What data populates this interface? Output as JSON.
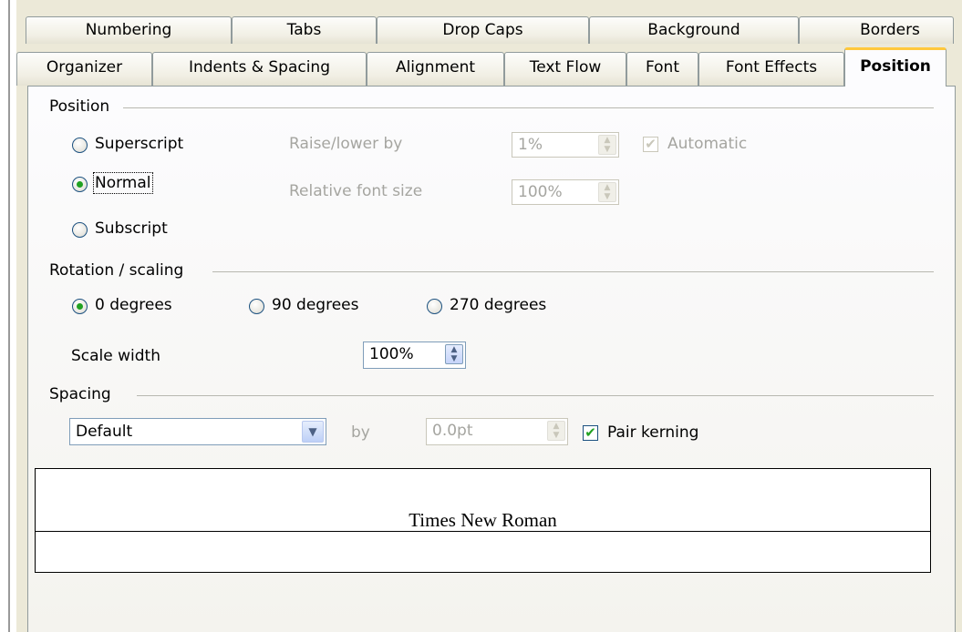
{
  "tabs_row1": [
    "Numbering",
    "Tabs",
    "Drop Caps",
    "Background",
    "Borders"
  ],
  "tabs_row2": [
    "Organizer",
    "Indents & Spacing",
    "Alignment",
    "Text Flow",
    "Font",
    "Font Effects",
    "Position"
  ],
  "active_tab": "Position",
  "position": {
    "group_label": "Position",
    "superscript": "Superscript",
    "normal": "Normal",
    "subscript": "Subscript",
    "selected": "Normal",
    "raise_lower_label": "Raise/lower by",
    "raise_lower_value": "1%",
    "automatic_label": "Automatic",
    "automatic_checked": true,
    "relative_size_label": "Relative font size",
    "relative_size_value": "100%"
  },
  "rotation": {
    "group_label": "Rotation / scaling",
    "opt_0": "0 degrees",
    "opt_90": "90 degrees",
    "opt_270": "270 degrees",
    "selected": "0 degrees",
    "scale_width_label": "Scale width",
    "scale_width_value": "100%"
  },
  "spacing": {
    "group_label": "Spacing",
    "select_value": "Default",
    "by_label": "by",
    "by_value": "0.0pt",
    "pair_kerning_label": "Pair kerning",
    "pair_kerning_checked": true
  },
  "preview": {
    "sample_text": "Times New Roman"
  }
}
